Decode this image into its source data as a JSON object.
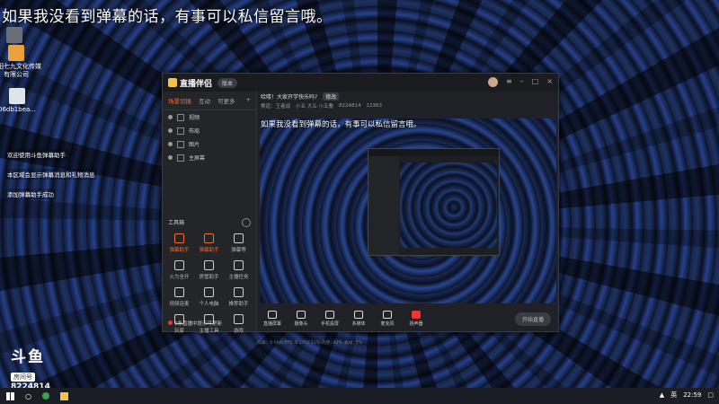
{
  "overlay_text": "如果我没看到弹幕的话，有事可以私信留言哦。",
  "desktop_icons": [
    {
      "label": "爱剪"
    },
    {
      "label": "沈阳七九文化传媒有限公司"
    },
    {
      "label": "06db1bea..."
    }
  ],
  "side_messages": [
    "欢迎使用斗鱼弹幕助手",
    "本区域会显示弹幕消息和礼物消息",
    "添加弹幕助手成功"
  ],
  "logo": {
    "name": "斗鱼",
    "room_label": "房间号",
    "room_id": "8224814"
  },
  "window": {
    "brand": "直播伴侣",
    "version": "版本",
    "left_tabs": [
      "场景切换",
      "互动",
      "可更多"
    ],
    "scenes": [
      "视频",
      "布局",
      "图片",
      "主屏幕"
    ],
    "tools_title": "工具箱",
    "tools": [
      "弹幕助手",
      "弹幕助手",
      "弹幕等",
      "火力全开",
      "房管助手",
      "主播任务",
      "视频连麦",
      "个人电脑",
      "推荐助手",
      "玩家",
      "主播工具",
      "游戏"
    ],
    "hint": "5条直播中提示可更新",
    "room_title": "哈喽！大家开学快乐吗?",
    "room_tag": "修改",
    "info": [
      "赛道：王者战",
      "小五 大五 小五叠",
      "8224814",
      "12363"
    ],
    "bottom_buttons": [
      "直播屏幕",
      "摄像头",
      "手机投屏",
      "多媒体",
      "麦克风",
      "扬声器"
    ],
    "start_button": "开始直播",
    "status": "码率：0 kb/s   FPS: 0   CPU: 11%   内存: 42%   丢帧: 0%"
  },
  "taskbar": {
    "time": "22:59",
    "lang": "英"
  }
}
